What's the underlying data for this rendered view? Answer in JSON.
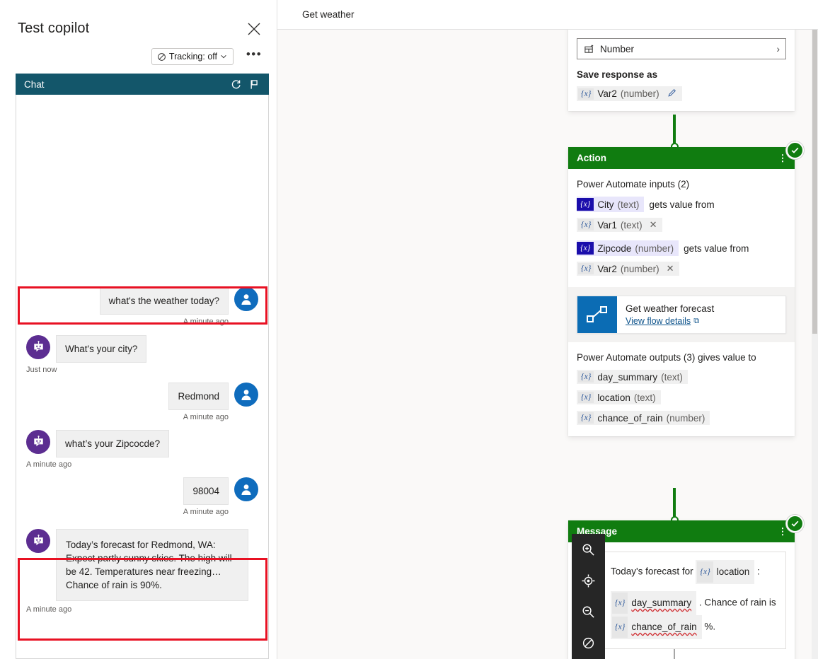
{
  "test_panel": {
    "title": "Test copilot",
    "close_label": "✕",
    "tracking": {
      "label": "Tracking: off",
      "chevron": "⌄"
    },
    "more_label": "•••",
    "chat": {
      "header_title": "Chat",
      "refresh_icon": "refresh-icon",
      "flag_icon": "flag-icon"
    },
    "messages": [
      {
        "author": "user",
        "text": "what's the weather today?",
        "time": "A minute ago",
        "highlighted": true
      },
      {
        "author": "bot",
        "text": "What's your city?",
        "time": "Just now",
        "highlighted": false
      },
      {
        "author": "user",
        "text": "Redmond",
        "time": "A minute ago",
        "highlighted": false
      },
      {
        "author": "bot",
        "text": "what’s your Zipcocde?",
        "time": "A minute ago",
        "highlighted": false
      },
      {
        "author": "user",
        "text": "98004",
        "time": "A minute ago",
        "highlighted": false
      },
      {
        "author": "bot",
        "text": "Today’s forecast for Redmond, WA: Expect partly sunny skies. The high will be 42. Temperatures near freezing… Chance of rain is 90%.",
        "time": "A minute ago",
        "highlighted": true
      }
    ]
  },
  "canvas": {
    "title": "Get weather",
    "question_node": {
      "identify_field": {
        "icon": "entity-icon",
        "value": "Number",
        "chevron": "›"
      },
      "save_response_label": "Save response as",
      "variable": {
        "token": "{x}",
        "name": "Var2",
        "type": "(number)",
        "edit_icon": "pencil-icon"
      }
    },
    "action_node": {
      "header": "Action",
      "inputs_label": "Power Automate inputs (2)",
      "inputs": [
        {
          "param": {
            "token": "{x}",
            "name": "City",
            "type": "(text)"
          },
          "connector_text": "gets value from",
          "value": {
            "token": "{x}",
            "name": "Var1",
            "type": "(text)",
            "remove": "✕"
          }
        },
        {
          "param": {
            "token": "{x}",
            "name": "Zipcode",
            "type": "(number)"
          },
          "connector_text": "gets value from",
          "value": {
            "token": "{x}",
            "name": "Var2",
            "type": "(number)",
            "remove": "✕"
          }
        }
      ],
      "flow": {
        "icon": "power-automate-icon",
        "name": "Get weather forecast",
        "link": "View flow details",
        "external_icon": "⧉"
      },
      "outputs_label": "Power Automate outputs (3) gives value to",
      "outputs": [
        {
          "token": "{x}",
          "name": "day_summary",
          "type": "(text)"
        },
        {
          "token": "{x}",
          "name": "location",
          "type": "(text)"
        },
        {
          "token": "{x}",
          "name": "chance_of_rain",
          "type": "(number)"
        }
      ]
    },
    "message_node": {
      "header": "Message",
      "avatar": "bot-avatar",
      "line1_prefix": "Today's forecast for ",
      "line1_var": {
        "token": "{x}",
        "name": "location"
      },
      "line1_suffix": " :",
      "line2_var": {
        "token": "{x}",
        "name": "day_summary"
      },
      "line2_mid": " . Chance of rain is ",
      "line3_var": {
        "token": "{x}",
        "name": "chance_of_rain"
      },
      "line3_suffix": " %."
    },
    "status_badges": [
      "completed-check",
      "completed-check"
    ],
    "zoom_toolbar": [
      {
        "name": "zoom-in-icon",
        "label": "Zoom in"
      },
      {
        "name": "fit-to-screen-icon",
        "label": "Fit to screen"
      },
      {
        "name": "zoom-out-icon",
        "label": "Zoom out"
      },
      {
        "name": "reset-view-icon",
        "label": "Reset view"
      }
    ]
  },
  "colors": {
    "chat_header": "#13566a",
    "node_green": "#107c10",
    "user_avatar": "#0f6cbd",
    "bot_avatar": "#5c2d91",
    "highlight_red": "#e81123",
    "param_blue": "#1a0dab",
    "flow_blue": "#0b6cb4"
  }
}
